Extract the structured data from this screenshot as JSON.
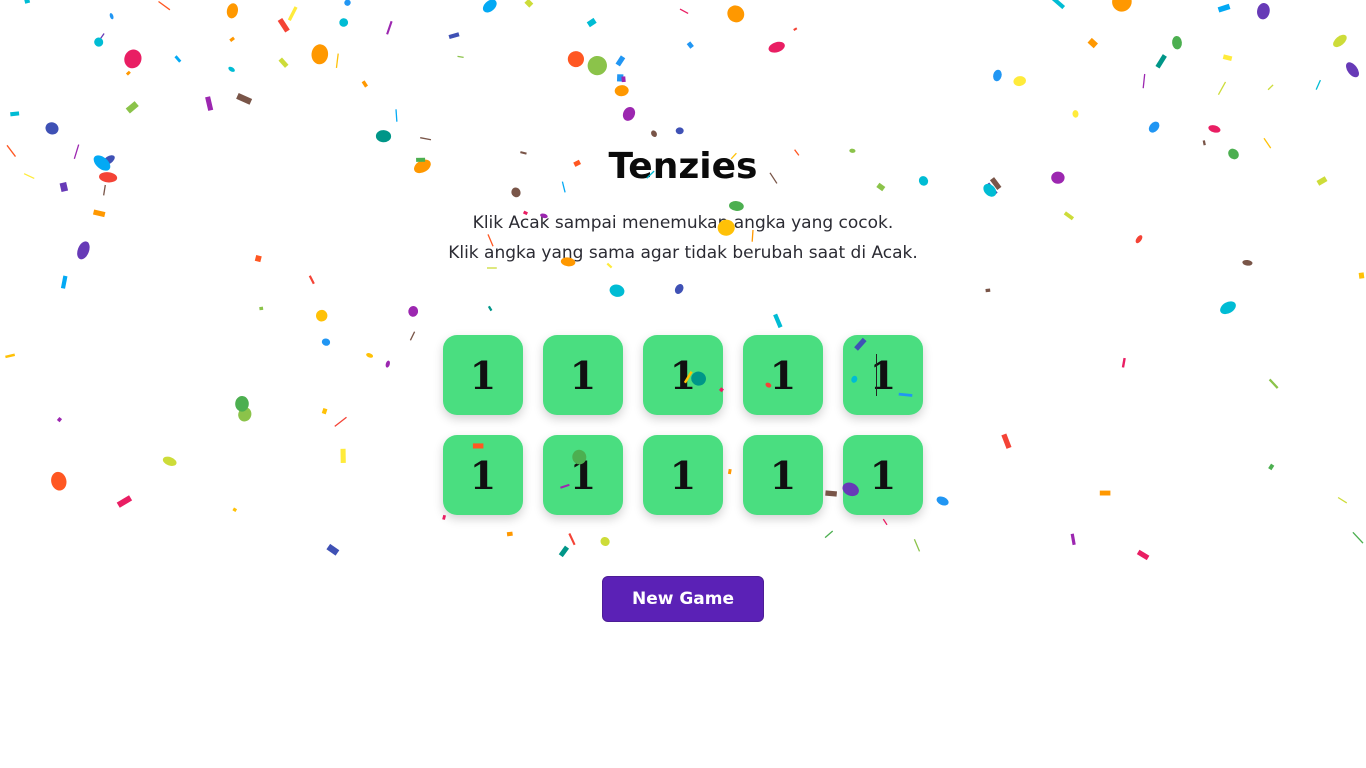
{
  "title": "Tenzies",
  "instructions": {
    "line1": "Klik Acak sampai menemukan angka yang cocok.",
    "line2": "Klik angka yang sama agar tidak berubah saat di Acak."
  },
  "dice": [
    {
      "value": "1",
      "held": true
    },
    {
      "value": "1",
      "held": true
    },
    {
      "value": "1",
      "held": true
    },
    {
      "value": "1",
      "held": true
    },
    {
      "value": "1",
      "held": true
    },
    {
      "value": "1",
      "held": true
    },
    {
      "value": "1",
      "held": true
    },
    {
      "value": "1",
      "held": true
    },
    {
      "value": "1",
      "held": true
    },
    {
      "value": "1",
      "held": true
    }
  ],
  "button": {
    "label": "New Game"
  },
  "colors": {
    "die_held": "#4ade80",
    "button_bg": "#5b21b6",
    "confetti": [
      "#f44336",
      "#e91e63",
      "#9c27b0",
      "#673ab7",
      "#3f51b5",
      "#2196f3",
      "#03a9f4",
      "#00bcd4",
      "#009688",
      "#4caf50",
      "#8bc34a",
      "#cddc39",
      "#ffeb3b",
      "#ffc107",
      "#ff9800",
      "#ff5722",
      "#795548"
    ]
  },
  "decoration": "confetti"
}
